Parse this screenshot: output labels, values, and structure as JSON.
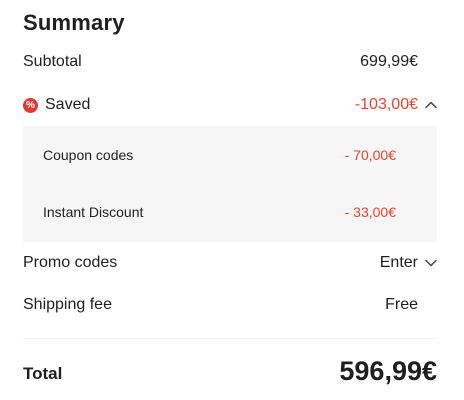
{
  "summary": {
    "title": "Summary",
    "subtotal": {
      "label": "Subtotal",
      "value": "699,99€"
    },
    "saved": {
      "icon": "percent-badge-icon",
      "label": "Saved",
      "value": "-103,00€",
      "expanded": true,
      "items": [
        {
          "label": "Coupon codes",
          "value": "- 70,00€"
        },
        {
          "label": "Instant Discount",
          "value": "- 33,00€"
        }
      ]
    },
    "promo": {
      "label": "Promo codes",
      "value": "Enter"
    },
    "shipping": {
      "label": "Shipping fee",
      "value": "Free"
    },
    "total": {
      "label": "Total",
      "value": "596,99€"
    }
  },
  "colors": {
    "accent_red": "#e8452f",
    "text": "#1f1f1f",
    "box_background": "#f6f6f6"
  }
}
